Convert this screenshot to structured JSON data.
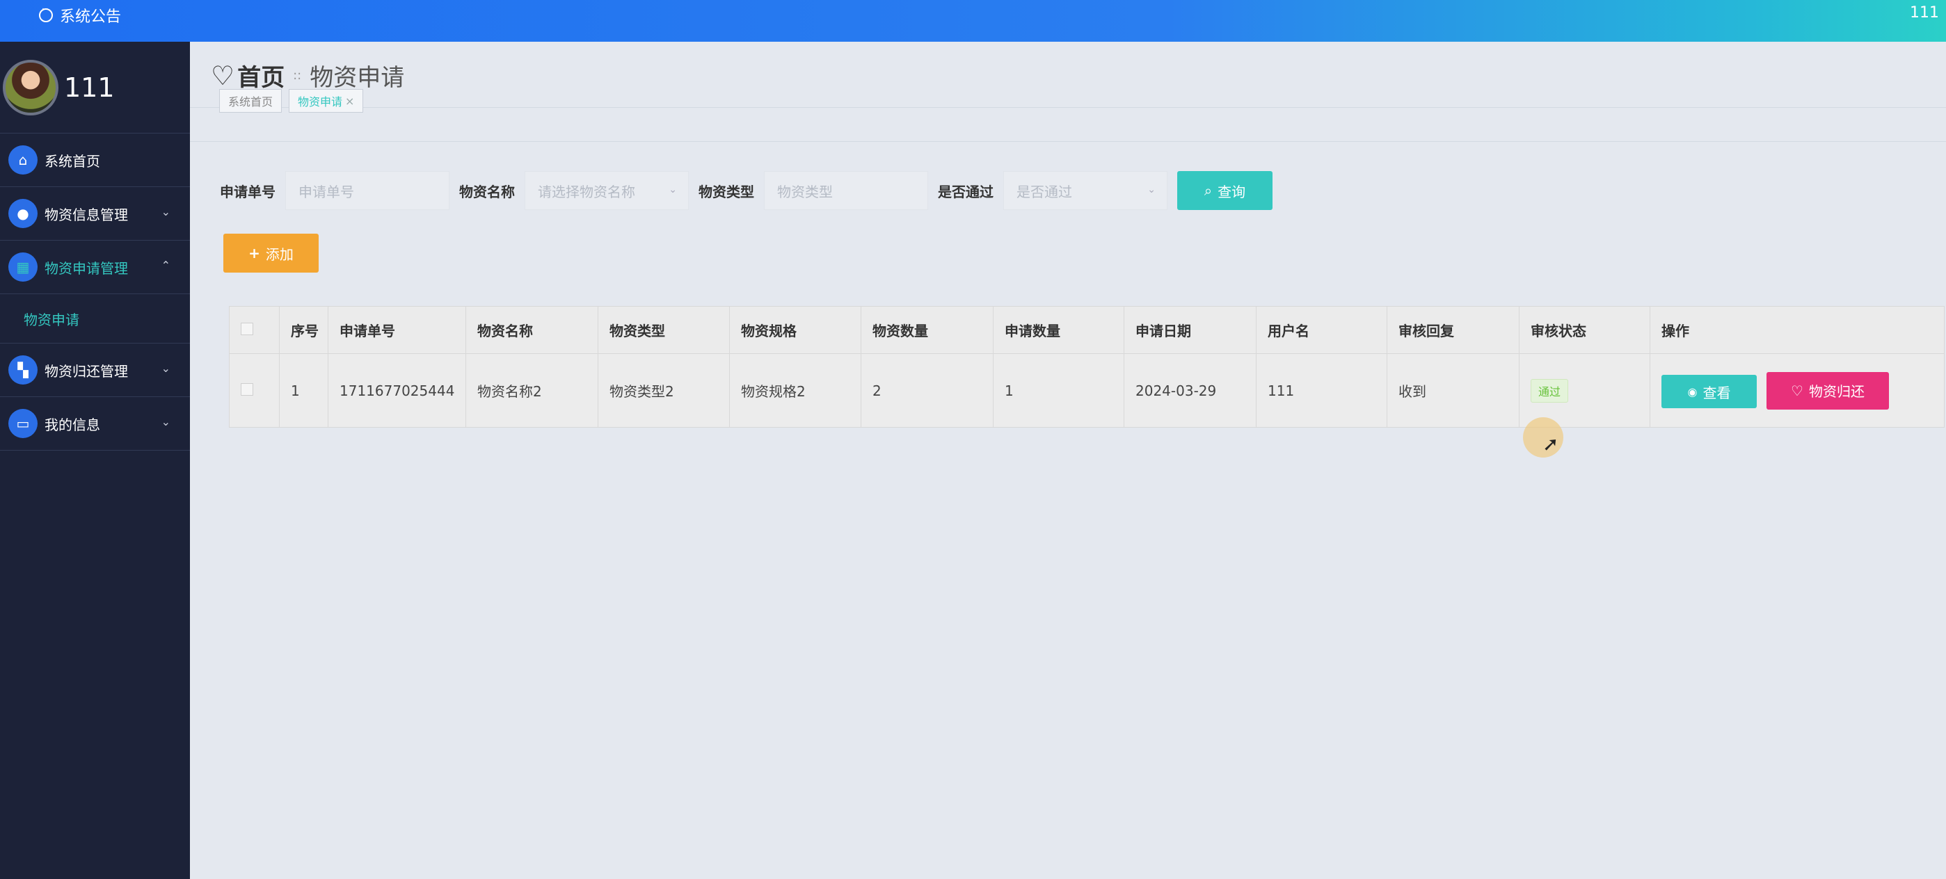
{
  "topbar": {
    "notice": "系统公告",
    "user": "111"
  },
  "sidebar": {
    "profile_name": "111",
    "items": [
      {
        "label": "系统首页",
        "icon": "home-icon"
      },
      {
        "label": "物资信息管理",
        "icon": "user-icon"
      },
      {
        "label": "物资申请管理",
        "icon": "grid-icon"
      },
      {
        "label": "物资归还管理",
        "icon": "apps-icon"
      },
      {
        "label": "我的信息",
        "icon": "wallet-icon"
      }
    ],
    "submenu": "物资申请"
  },
  "breadcrumb": {
    "home": "首页",
    "current": "物资申请"
  },
  "tabs": [
    {
      "label": "系统首页"
    },
    {
      "label": "物资申请"
    }
  ],
  "search": {
    "fields": [
      {
        "label": "申请单号",
        "placeholder": "申请单号"
      },
      {
        "label": "物资名称",
        "placeholder": "请选择物资名称"
      },
      {
        "label": "物资类型",
        "placeholder": "物资类型"
      },
      {
        "label": "是否通过",
        "placeholder": "是否通过"
      }
    ],
    "query_button": "查询"
  },
  "add_button": "添加",
  "table": {
    "headers": [
      "序号",
      "申请单号",
      "物资名称",
      "物资类型",
      "物资规格",
      "物资数量",
      "申请数量",
      "申请日期",
      "用户名",
      "审核回复",
      "审核状态",
      "操作"
    ],
    "rows": [
      {
        "index": "1",
        "order_no": "1711677025444",
        "name": "物资名称2",
        "type": "物资类型2",
        "spec": "物资规格2",
        "stock": "2",
        "qty": "1",
        "date": "2024-03-29",
        "user": "111",
        "reply": "收到",
        "status": "通过",
        "view": "查看",
        "return": "物资归还"
      }
    ]
  },
  "colors": {
    "accent": "#34c7c0",
    "warning": "#f3a531",
    "danger": "#e8307a",
    "sidebar": "#1c2238"
  }
}
